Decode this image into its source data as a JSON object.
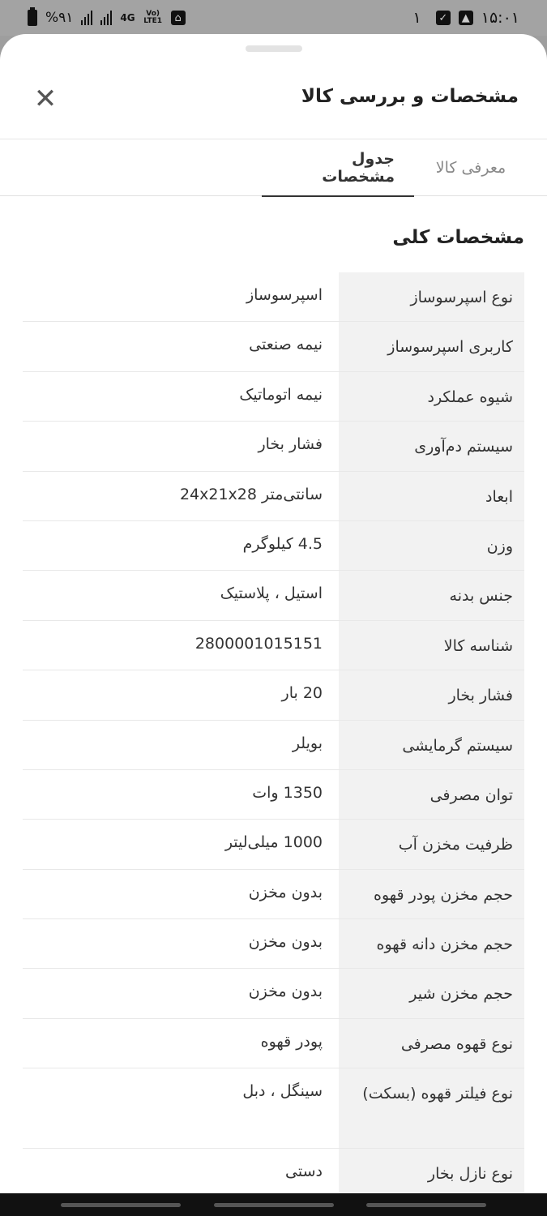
{
  "status_bar": {
    "time": "۱۵:۰۱",
    "notification_count": "۱",
    "battery": "%۹۱",
    "network": "4G",
    "volte": "Vo) LTE1"
  },
  "sheet": {
    "title": "مشخصات و بررسی کالا",
    "close_glyph": "✕"
  },
  "tabs": [
    {
      "label": "معرفی کالا",
      "active": false
    },
    {
      "label": "جدول مشخصات",
      "active": true
    }
  ],
  "section": {
    "title": "مشخصات کلی"
  },
  "specs": [
    {
      "key": "نوع اسپرسوساز",
      "value": "اسپرسوساز"
    },
    {
      "key": "کاربری اسپرسوساز",
      "value": "نیمه صنعتی"
    },
    {
      "key": "شیوه عملکرد",
      "value": "نیمه اتوماتیک"
    },
    {
      "key": "سیستم دم‌آوری",
      "value": "فشار بخار"
    },
    {
      "key": "ابعاد",
      "value": "سانتی‌متر 24x21x28"
    },
    {
      "key": "وزن",
      "value": "4.5 کیلوگرم"
    },
    {
      "key": "جنس بدنه",
      "value": "استیل ، پلاستیک"
    },
    {
      "key": "شناسه کالا",
      "value": "2800001015151"
    },
    {
      "key": "فشار بخار",
      "value": "20 بار"
    },
    {
      "key": "سیستم گرمایشی",
      "value": "بویلر"
    },
    {
      "key": "توان مصرفی",
      "value": "1350 وات"
    },
    {
      "key": "ظرفیت مخزن آب",
      "value": "1000 میلی‌لیتر"
    },
    {
      "key": "حجم مخزن پودر قهوه",
      "value": "بدون مخزن"
    },
    {
      "key": "حجم مخزن دانه قهوه",
      "value": "بدون مخزن"
    },
    {
      "key": "حجم مخزن شیر",
      "value": "بدون مخزن"
    },
    {
      "key": "نوع قهوه مصرفی",
      "value": "پودر قهوه"
    },
    {
      "key": "نوع فیلتر قهوه (بسکت)",
      "value": "سینگل ، دبل"
    },
    {
      "key": "نوع نازل بخار",
      "value": "دستی"
    }
  ]
}
